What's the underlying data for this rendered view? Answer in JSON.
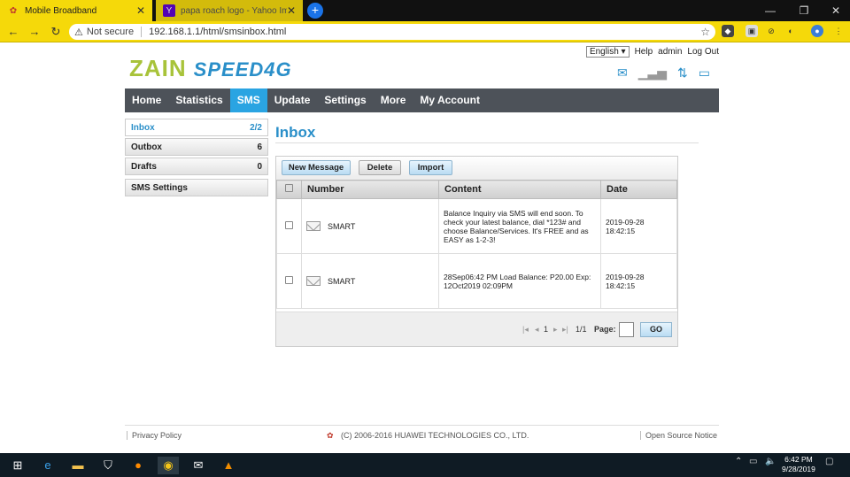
{
  "browser": {
    "tabs": [
      {
        "label": "Mobile Broadband",
        "active": true
      },
      {
        "label": "papa roach logo - Yahoo Image",
        "active": false
      }
    ],
    "address": {
      "security": "Not secure",
      "url": "192.168.1.1/html/smsinbox.html"
    },
    "accent": "#f5d90a"
  },
  "header": {
    "language": "English",
    "links": [
      "Help",
      "admin",
      "Log Out"
    ],
    "logo_brand": "ZAIN",
    "logo_product": "SPEED4G"
  },
  "nav": {
    "items": [
      "Home",
      "Statistics",
      "SMS",
      "Update",
      "Settings",
      "More",
      "My Account"
    ],
    "selected": "SMS"
  },
  "sidebar": {
    "items": [
      {
        "label": "Inbox",
        "count": "2/2"
      },
      {
        "label": "Outbox",
        "count": "6"
      },
      {
        "label": "Drafts",
        "count": "0"
      },
      {
        "label": "SMS Settings",
        "count": ""
      }
    ]
  },
  "main": {
    "title": "Inbox",
    "actions": [
      "New Message",
      "Delete",
      "Import"
    ],
    "columns": [
      "Number",
      "Content",
      "Date"
    ],
    "messages": [
      {
        "number": "SMART",
        "content": "Balance Inquiry via SMS will end soon. To check your latest balance, dial *123# and choose Balance/Services. It's FREE and as EASY as 1-2-3!",
        "date": "2019-09-28 18:42:15"
      },
      {
        "number": "SMART",
        "content": "28Sep06:42 PM Load Balance: P20.00 Exp: 12Oct2019 02:09PM",
        "date": "2019-09-28 18:42:15"
      }
    ],
    "pager": {
      "current": "1",
      "total": "1/1",
      "page_label": "Page:",
      "go": "GO"
    }
  },
  "footer": {
    "privacy": "Privacy Policy",
    "copyright": "(C) 2006-2016 HUAWEI TECHNOLOGIES CO., LTD.",
    "open_source": "Open Source Notice"
  },
  "taskbar": {
    "time": "6:42 PM",
    "date": "9/28/2019"
  }
}
